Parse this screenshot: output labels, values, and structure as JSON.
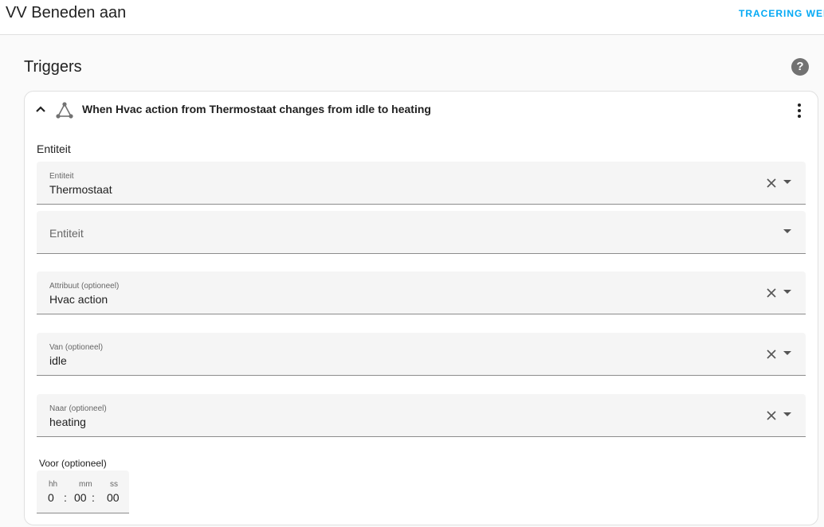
{
  "header": {
    "title": "VV Beneden aan",
    "trace_link": "TRACERING WEER"
  },
  "section": {
    "title": "Triggers",
    "help_icon": "help-circle-icon"
  },
  "trigger": {
    "summary": "When Hvac action from Thermostaat changes from idle to heating",
    "icon": "state-trigger-icon",
    "entity_heading": "Entiteit",
    "fields": {
      "entity": {
        "label": "Entiteit",
        "value": "Thermostaat"
      },
      "entity_add": {
        "placeholder": "Entiteit"
      },
      "attribute": {
        "label": "Attribuut (optioneel)",
        "value": "Hvac action"
      },
      "from": {
        "label": "Van (optioneel)",
        "value": "idle"
      },
      "to": {
        "label": "Naar (optioneel)",
        "value": "heating"
      }
    },
    "duration": {
      "label": "Voor (optioneel)",
      "hh_label": "hh",
      "mm_label": "mm",
      "ss_label": "ss",
      "hh": "0",
      "mm": "00",
      "ss": "00",
      "separator": ":"
    }
  },
  "colors": {
    "accent": "#03a9f4",
    "field_bg": "#f5f5f5",
    "page_bg": "#fafafa"
  }
}
